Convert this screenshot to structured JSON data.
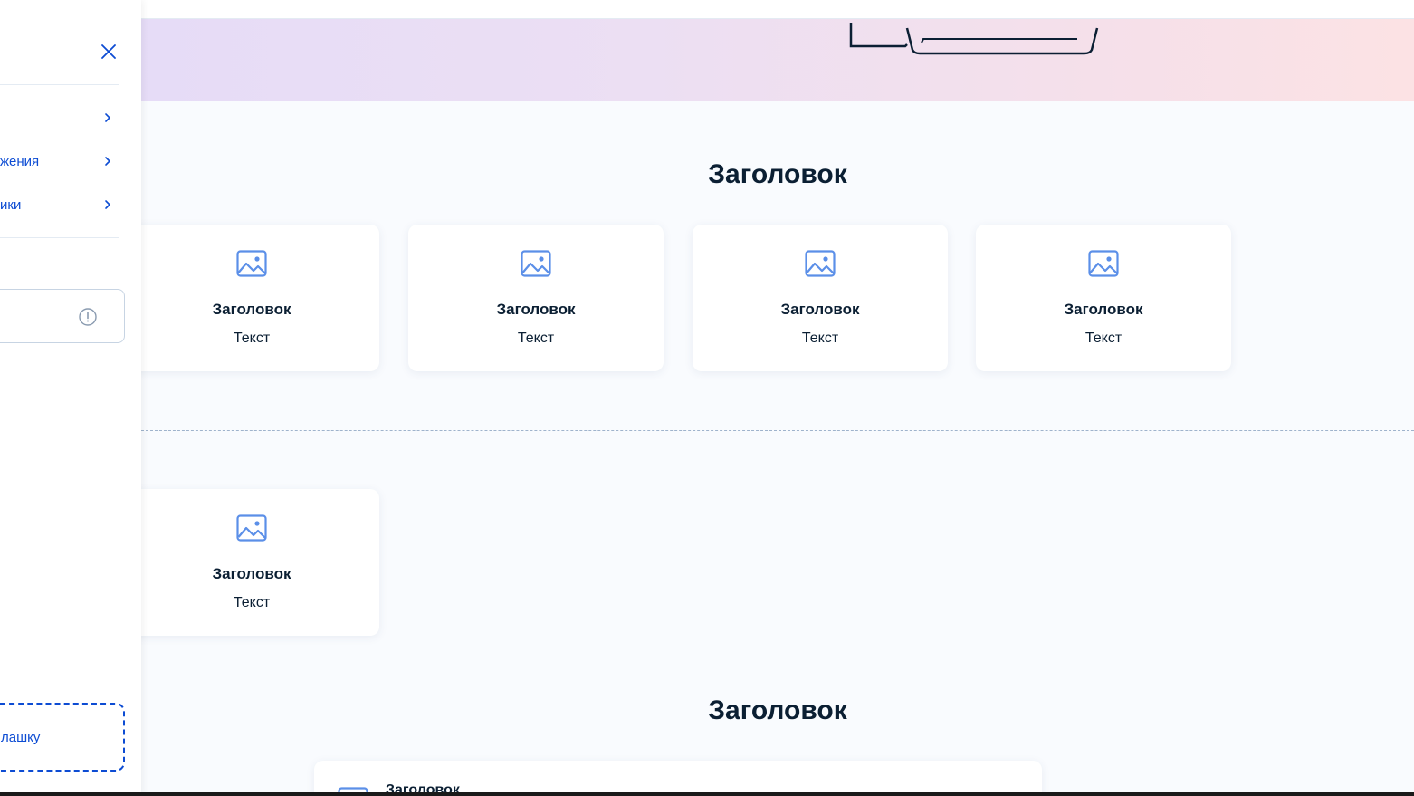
{
  "sidebar": {
    "menu": [
      {
        "label": ""
      },
      {
        "label": "жения"
      },
      {
        "label": "ики"
      }
    ],
    "input_value": "",
    "add_button_label": "лашку"
  },
  "sections": [
    {
      "title": "Заголовок",
      "cards": [
        {
          "title": "Заголовок",
          "text": "Текст"
        },
        {
          "title": "Заголовок",
          "text": "Текст"
        },
        {
          "title": "Заголовок",
          "text": "Текст"
        },
        {
          "title": "Заголовок",
          "text": "Текст"
        }
      ]
    },
    {
      "cards": [
        {
          "title": "Заголовок",
          "text": "Текст"
        }
      ]
    },
    {
      "title": "Заголовок",
      "list_item_title": "Заголовок"
    }
  ],
  "colors": {
    "accent": "#0d4cd3",
    "icon": "#5b8fe8",
    "text": "#0b1f33"
  },
  "icons": {
    "close": "close-icon",
    "chevron": "chevron-right-icon",
    "info": "info-icon",
    "image": "image-icon"
  }
}
